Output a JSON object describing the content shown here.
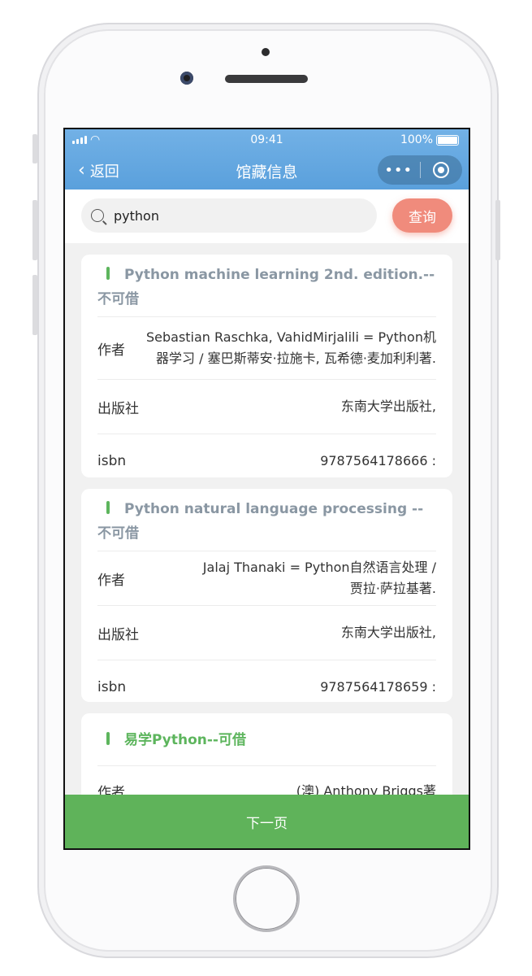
{
  "status": {
    "time": "09:41",
    "battery": "100%"
  },
  "nav": {
    "back_label": "返回",
    "title": "馆藏信息",
    "more_icon": "more-dots-icon",
    "close_icon": "target-icon"
  },
  "search": {
    "value": "python",
    "button": "查询"
  },
  "labels": {
    "author": "作者",
    "publisher": "出版社",
    "isbn": "isbn"
  },
  "books": [
    {
      "title": "Python machine learning 2nd. edition.--不可借",
      "author": "Sebastian Raschka, VahidMirjalili = Python机器学习 / 塞巴斯蒂安·拉施卡, 瓦希德·麦加利利著.",
      "publisher": "东南大学出版社,",
      "isbn": "9787564178666 :",
      "available": false
    },
    {
      "title": "Python natural language processing --不可借",
      "author": "Jalaj Thanaki = Python自然语言处理 / 贾拉·萨拉基著.",
      "publisher": "东南大学出版社,",
      "isbn": "9787564178659 :",
      "available": false
    },
    {
      "title": "易学Python--可借",
      "author": "(澳) Anthony Briggs著",
      "available": true
    }
  ],
  "footer": {
    "next_label": "下一页"
  },
  "colors": {
    "header": "#5aa0dc",
    "accent_green": "#5fb35a",
    "query_button": "#f08b7c",
    "title_grey": "#8a97a3"
  }
}
